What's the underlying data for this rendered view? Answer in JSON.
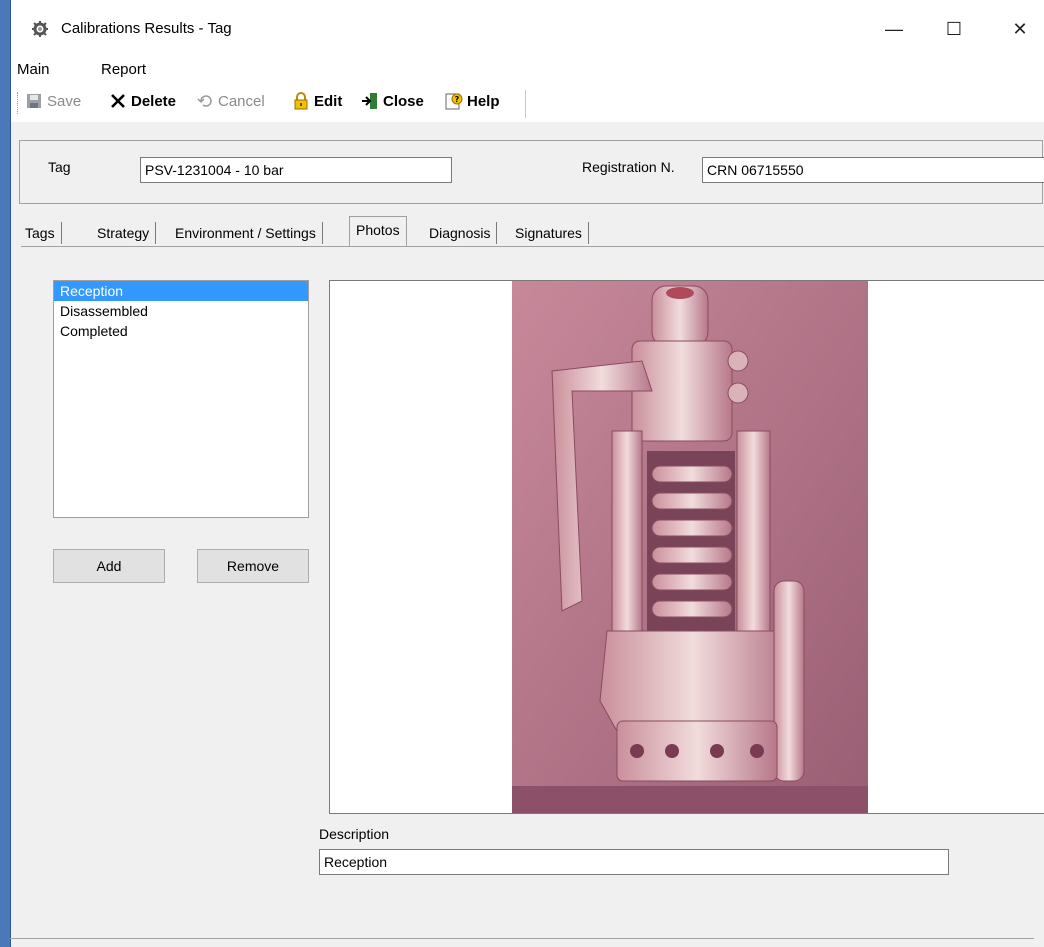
{
  "window": {
    "title": "Calibrations Results - Tag",
    "controls": {
      "minimize": "—",
      "maximize": "☐",
      "close": "✕"
    }
  },
  "menu": [
    "Main",
    "Report"
  ],
  "toolbar": {
    "save_label": "Save",
    "delete_label": "Delete",
    "cancel_label": "Cancel",
    "edit_label": "Edit",
    "close_label": "Close",
    "help_label": "Help"
  },
  "header": {
    "tag_label": "Tag",
    "tag_value": "PSV-1231004 - 10 bar",
    "registration_label": "Registration N.",
    "registration_value": "CRN 06715550"
  },
  "tabs": [
    {
      "label": "Tags"
    },
    {
      "label": "Strategy"
    },
    {
      "label": "Environment / Settings"
    },
    {
      "label": "Photos",
      "active": true
    },
    {
      "label": "Diagnosis"
    },
    {
      "label": "Signatures"
    }
  ],
  "photos": {
    "items": [
      "Reception",
      "Disassembled",
      "Completed"
    ],
    "selected": "Reception",
    "add_label": "Add",
    "remove_label": "Remove",
    "description_label": "Description",
    "description_value": "Reception"
  },
  "colors": {
    "selection": "#3399ff",
    "window_border": "#2b579a",
    "photo_tint": "#b97a8a"
  }
}
